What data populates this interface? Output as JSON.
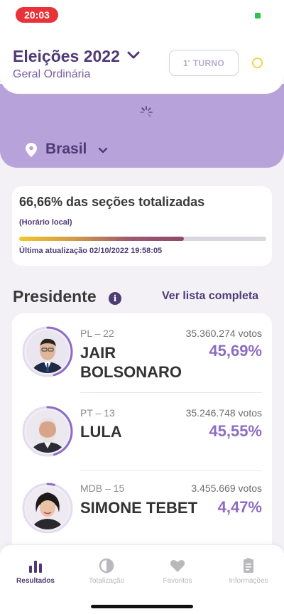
{
  "status_bar": {
    "time": "20:03"
  },
  "header": {
    "title": "Eleições 2022",
    "subtitle": "Geral Ordinária",
    "turno_number": "1",
    "turno_sup": "º",
    "turno_label": "TURNO"
  },
  "location": {
    "label": "Brasil"
  },
  "progress": {
    "sections_text": "66,66% das seções totalizadas",
    "local_time": "(Horário local)",
    "percent": 66.66,
    "last_update": "Última atualização 02/10/2022 19:58:05"
  },
  "presidente": {
    "title": "Presidente",
    "see_all": "Ver lista completa",
    "candidates": [
      {
        "party": "PL – 22",
        "name": "JAIR BOLSONARO",
        "votes": "35.360.274 votos",
        "percent_text": "45,69%",
        "percent": 45.69
      },
      {
        "party": "PT – 13",
        "name": "LULA",
        "votes": "35.246.748 votos",
        "percent_text": "45,55%",
        "percent": 45.55
      },
      {
        "party": "MDB – 15",
        "name": "SIMONE TEBET",
        "votes": "3.455.669 votos",
        "percent_text": "4,47%",
        "percent": 4.47
      }
    ]
  },
  "nav": {
    "items": [
      {
        "label": "Resultados",
        "icon": "bar-chart-icon",
        "active": true
      },
      {
        "label": "Totalização",
        "icon": "pie-chart-icon",
        "active": false
      },
      {
        "label": "Favoritos",
        "icon": "heart-icon",
        "active": false
      },
      {
        "label": "Informações",
        "icon": "clipboard-icon",
        "active": false
      }
    ]
  },
  "colors": {
    "brand_purple": "#4f3a76",
    "accent_purple": "#8e6cc2",
    "band_purple": "#b7a2da",
    "time_red": "#e8333b"
  }
}
